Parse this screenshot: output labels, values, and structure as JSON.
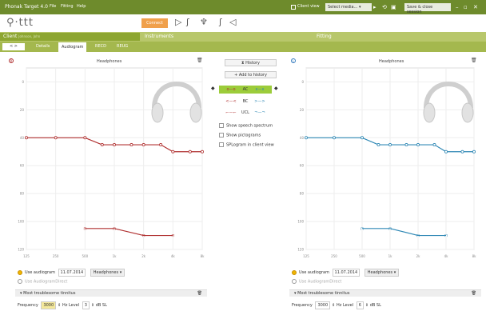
{
  "app": {
    "title": "Phonak Target 4.0",
    "menus": [
      "File",
      "Fitting",
      "Help"
    ],
    "client_view": "Client view",
    "select_media": "Select media...",
    "save_close": "Save & close session"
  },
  "toolbar": {
    "connect": "Connect"
  },
  "steps": {
    "client": "Client",
    "client_sub": "Johnson, John",
    "instruments": "Instruments",
    "fitting": "Fitting"
  },
  "subtabs": {
    "nav": "< >",
    "items": [
      "Details",
      "Audiogram",
      "RECD",
      "REUG"
    ]
  },
  "left": {
    "ear": "R",
    "title": "Headphones",
    "use_audiogram": "Use audiogram",
    "date": "11.07.2014",
    "device": "Headphones",
    "use_direct": "Use AudiogramDirect",
    "tinnitus": "Most troublesome tinnitus",
    "frequency_label": "Frequency",
    "frequency": "3000",
    "hz": "Hz",
    "level_label": "Level",
    "level": "3",
    "dbsl": "dB SL"
  },
  "right": {
    "ear": "L",
    "title": "Headphones",
    "use_audiogram": "Use audiogram",
    "date": "11.07.2014",
    "device": "Headphones",
    "use_direct": "Use AudiogramDirect",
    "tinnitus": "Most troublesome tinnitus",
    "frequency_label": "Frequency",
    "frequency": "3000",
    "hz": "Hz",
    "level_label": "Level",
    "level": "6",
    "dbsl": "dB SL"
  },
  "center": {
    "history": "History",
    "add_history": "Add to history",
    "legend": [
      {
        "label": "AC"
      },
      {
        "label": "BC"
      },
      {
        "label": "UCL"
      }
    ],
    "opts": [
      "Show speech spectrum",
      "Show pictograms",
      "SPLogram in client view"
    ]
  },
  "colors": {
    "right": "#b03030",
    "left": "#2f88b5",
    "brand": "#8da631"
  },
  "chart_data": [
    {
      "type": "line",
      "ear": "right",
      "title": "Headphones",
      "x": [
        125,
        250,
        500,
        750,
        1000,
        1500,
        2000,
        3000,
        4000,
        6000,
        8000
      ],
      "series": [
        {
          "name": "AC",
          "values": [
            40,
            40,
            40,
            45,
            45,
            45,
            45,
            45,
            50,
            50,
            50
          ]
        },
        {
          "name": "UCL",
          "x": [
            500,
            1000,
            2000,
            4000
          ],
          "values": [
            105,
            105,
            110,
            110
          ]
        }
      ],
      "ylim": [
        -10,
        120
      ],
      "x_ticks": [
        "125",
        "250",
        "500",
        "1k",
        "2k",
        "4k",
        "8k"
      ],
      "y_ticks": [
        "0",
        "20",
        "40",
        "60",
        "80",
        "100",
        "120"
      ]
    },
    {
      "type": "line",
      "ear": "left",
      "title": "Headphones",
      "x": [
        125,
        250,
        500,
        750,
        1000,
        1500,
        2000,
        3000,
        4000,
        6000,
        8000
      ],
      "series": [
        {
          "name": "AC",
          "values": [
            40,
            40,
            40,
            45,
            45,
            45,
            45,
            45,
            50,
            50,
            50
          ]
        },
        {
          "name": "UCL",
          "x": [
            500,
            1000,
            2000,
            4000
          ],
          "values": [
            105,
            105,
            110,
            110
          ]
        }
      ],
      "ylim": [
        -10,
        120
      ],
      "x_ticks": [
        "125",
        "250",
        "500",
        "1k",
        "2k",
        "4k",
        "8k"
      ],
      "y_ticks": [
        "0",
        "20",
        "40",
        "60",
        "80",
        "100",
        "120"
      ]
    }
  ]
}
